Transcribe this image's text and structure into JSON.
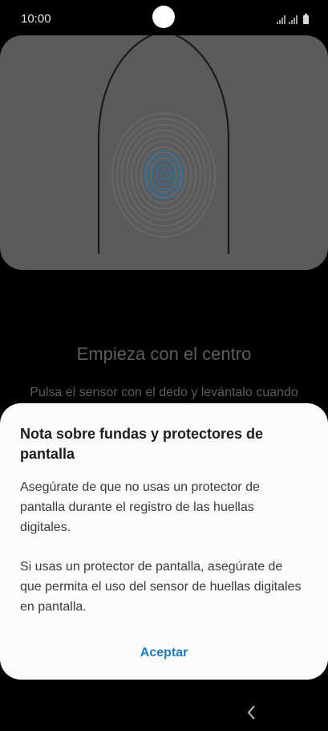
{
  "status_bar": {
    "time": "10:00"
  },
  "background": {
    "title": "Empieza con el centro",
    "subtitle": "Pulsa el sensor con el dedo y levántalo cuando"
  },
  "dialog": {
    "title": "Nota sobre fundas y protectores de pantalla",
    "paragraph1": "Asegúrate de que no usas un protector de pantalla durante el registro de las huellas digitales.",
    "paragraph2": "Si usas un protector de pantalla, asegúrate de que permita el uso del sensor de huellas digitales en pantalla.",
    "accept_label": "Aceptar"
  },
  "colors": {
    "accent": "#1d7bbd",
    "dialog_bg": "#fbfbfb",
    "card_bg": "#5b5b5b"
  },
  "icons": {
    "back": "chevron-left-icon",
    "battery": "battery-icon",
    "signal": "signal-icon"
  }
}
